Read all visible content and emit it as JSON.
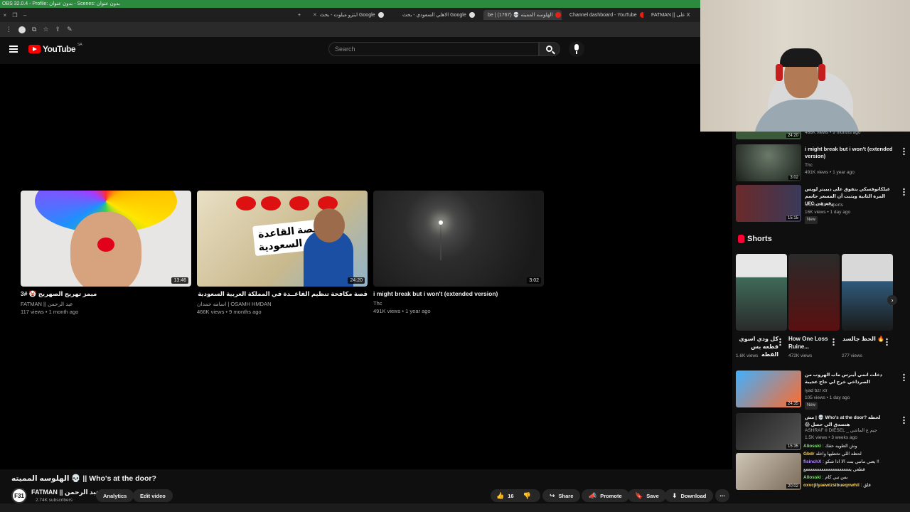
{
  "obs": {
    "title": "OBS 32.0.4 - Profile: بدون عنوان - Scenes: بدون عنوان"
  },
  "browser": {
    "tabs": [
      {
        "label": "ايتزو ميلوت - بحث Google",
        "favicon": "google"
      },
      {
        "label": "الاهلي السعودي - بحث Google",
        "favicon": "google"
      },
      {
        "label": "be | الهلوسه المميته 💀 (1767)",
        "favicon": "youtube",
        "active": true
      },
      {
        "label": "Channel dashboard - YouTube",
        "favicon": "youtube"
      },
      {
        "label": "FATMAN || على X",
        "favicon": "x"
      }
    ],
    "new_tab": "+"
  },
  "youtube": {
    "logo": "YouTube",
    "region": "SA",
    "search_placeholder": "Search"
  },
  "endcards": [
    {
      "title": "ميمز تهريج الصهريج 🤡 #3",
      "channel": "FATMAN || عبد الرحمن",
      "meta": "117 views • 1 month ago",
      "duration": "13:46"
    },
    {
      "title": "قصة مكافحة تنظيم القاعــدة في المملكة العربية السعودية (القصة كاملة)",
      "channel": "اسامه حمدان | OSAMH HMDAN",
      "meta": "466K views • 9 months ago",
      "duration": "24:20",
      "thumb_text": "قصة القاعدة في السعودية"
    },
    {
      "title": "i might break but i won't (extended version)",
      "channel": "Thc",
      "meta": "491K views • 1 year ago",
      "duration": "3:02"
    }
  ],
  "video": {
    "title": "الهلوسه المميته 💀 || Who's at the door?",
    "channel": "FATMAN || عبد الرحمن",
    "avatar_text": "F31",
    "subscribers": "2.74K subscribers",
    "analytics": "Analytics",
    "edit": "Edit video",
    "likes": "16",
    "share": "Share",
    "promote": "Promote",
    "save": "Save",
    "download": "Download"
  },
  "sidebar": {
    "top_item": {
      "meta": "466K views • 9 months ago",
      "duration": "24:20"
    },
    "items": [
      {
        "title": "i might break but i won't (extended version)",
        "channel": "Thc",
        "meta": "491K views • 1 year ago",
        "duration": "3:02"
      },
      {
        "title": "غيلكانوفسكي يتفوق على ديبيتر لويس المرة الثانية ويثبت أن المسعر حاسم رقم في UFC",
        "channel": "MMA Arab Experts",
        "meta": "16K views • 1 day ago",
        "duration": "15:15",
        "badge": "New"
      }
    ],
    "shorts_heading": "Shorts",
    "shorts": [
      {
        "title": "كل ودي اسوي قطعه بس القطه",
        "views": "1.6K views"
      },
      {
        "title": "How One Loss Ruine...",
        "views": "472K views"
      },
      {
        "title": "🔥 الحظ جالسد",
        "views": "277 views"
      }
    ],
    "items2": [
      {
        "title": "دخلت انمي أيبرس ماب الهروب من الصرداخي خرج لي حاج عجيبة",
        "channel": "iyad bzr xtr",
        "meta": "105 views • 1 day ago",
        "duration": "24:35",
        "badge": "New"
      },
      {
        "title": "لحظه ?Who's at the door 💀 | مش هتصدق الي حصل 😱",
        "channel": "ASHRAF II DIESEL _ جيم ع الماشي",
        "meta": "1.5K views • 3 weeks ago",
        "duration": "15:35"
      },
      {
        "title": "",
        "channel": "",
        "meta": "",
        "duration": "20:02"
      }
    ]
  },
  "chat": [
    {
      "user": "Aliosski",
      "text": ": وش الطويه حقك"
    },
    {
      "user": "Gbdr",
      "text": "لحظه اللي تخطيها واخلد"
    },
    {
      "user": "fisinchX",
      "text": ": يعني ماتبي بنت الا اذا شكو !!"
    },
    {
      "user": "",
      "text": "قطعي يععععععععععععععععععععع"
    },
    {
      "user": "Aliosski",
      "text": ": بس تبي كام"
    },
    {
      "user": "oxvcjilyaewizsibueqnwhil",
      "text": ": قلق"
    }
  ],
  "colors": {
    "accent": "#ff0000",
    "bg": "#0f0f0f",
    "obs_bar": "#2b8a3e"
  }
}
